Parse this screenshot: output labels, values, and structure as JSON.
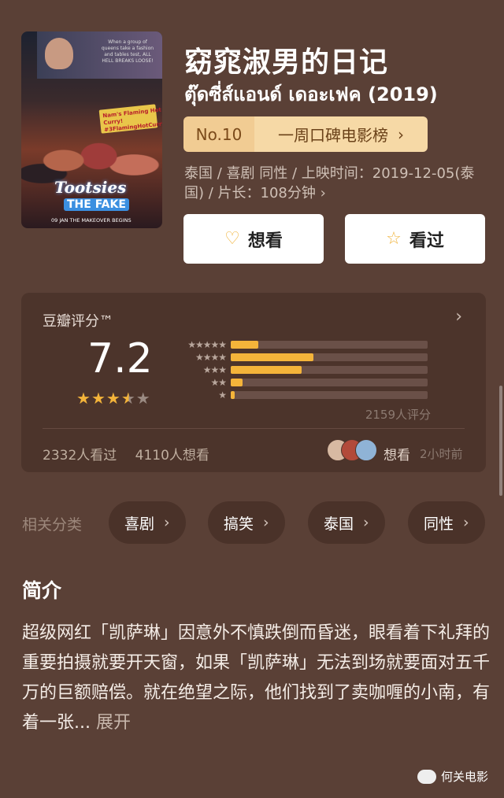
{
  "movie": {
    "title": "窈窕淑男的日记",
    "original_title": "ตุ๊ดซี่ส์แอนด์ เดอะเฟค (2019)",
    "meta_line1": "泰国 / 喜剧 同性 / 上映时间：2019-12-05(泰",
    "meta_line2": "国) / 片长：108分钟 ›",
    "rank_no": "No.10",
    "rank_label": "一周口碑电影榜",
    "poster": {
      "banner_text": "When a group of queens take a fashion and tables test, ALL HELL BREAKS LOOSE!",
      "sign_text": "Nam's Flaming Hot Curry! #3FlamingHotCurry",
      "title1": "Tootsies",
      "title2": "THE FAKE",
      "tagline": "09 JAN THE MAKEOVER BEGINS"
    }
  },
  "actions": {
    "want_label": "想看",
    "seen_label": "看过",
    "want_icon": "heart-plus-icon",
    "seen_icon": "star-outline-icon"
  },
  "rating": {
    "title": "豆瓣评分™",
    "score": "7.2",
    "stars": 3.5,
    "distribution": [
      {
        "stars": 5,
        "fraction": 0.14
      },
      {
        "stars": 4,
        "fraction": 0.42
      },
      {
        "stars": 3,
        "fraction": 0.36
      },
      {
        "stars": 2,
        "fraction": 0.06
      },
      {
        "stars": 1,
        "fraction": 0.02
      }
    ],
    "rating_count": "2159人评分",
    "watched": "2332人看过",
    "wanted": "4110人想看",
    "friend_action": "想看",
    "friend_time": "2小时前"
  },
  "related": {
    "label": "相关分类",
    "chips": [
      "喜剧",
      "搞笑",
      "泰国",
      "同性"
    ]
  },
  "intro": {
    "heading": "简介",
    "text": "超级网红「凯萨琳」因意外不慎跌倒而昏迷，眼看着下礼拜的重要拍摄就要开天窗，如果「凯萨琳」无法到场就要面对五千万的巨额赔偿。就在绝望之际，他们找到了卖咖喱的小南，有着一张...",
    "more": "展开"
  },
  "watermark": "何关电影",
  "colors": {
    "background": "#5a4036",
    "card": "#4c342b",
    "star": "#f4b43a",
    "rank_bg": "#f6d9a6"
  }
}
